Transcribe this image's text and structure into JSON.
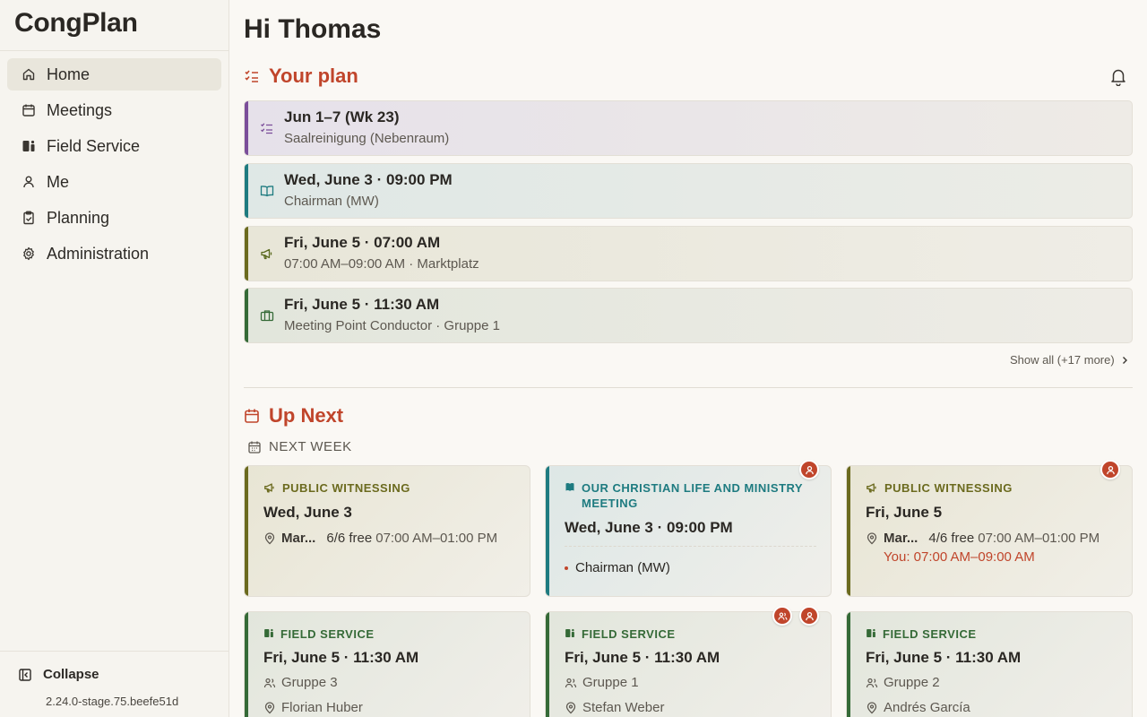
{
  "app": {
    "title": "CongPlan",
    "version": "2.24.0-stage.75.beefe51d"
  },
  "sidebar": {
    "items": [
      {
        "label": "Home",
        "icon": "home-icon",
        "active": true
      },
      {
        "label": "Meetings",
        "icon": "calendar-icon"
      },
      {
        "label": "Field Service",
        "icon": "field-service-icon"
      },
      {
        "label": "Me",
        "icon": "user-icon"
      },
      {
        "label": "Planning",
        "icon": "clipboard-check-icon"
      },
      {
        "label": "Administration",
        "icon": "gear-icon"
      }
    ],
    "collapse_label": "Collapse"
  },
  "greeting": "Hi Thomas",
  "your_plan": {
    "title": "Your plan",
    "items": [
      {
        "title": "Jun 1–7 (Wk 23)",
        "subtitle": "Saalreinigung (Nebenraum)",
        "icon": "checklist-icon",
        "accent": "#7b4e9a"
      },
      {
        "title": "Wed, June 3 · 09:00 PM",
        "subtitle": "Chairman (MW)",
        "icon": "book-open-icon",
        "accent": "#1e7b80"
      },
      {
        "title": "Fri, June 5 · 07:00 AM",
        "subtitle": "07:00 AM–09:00 AM · Marktplatz",
        "icon": "megaphone-icon",
        "accent": "#6b6a1e"
      },
      {
        "title": "Fri, June 5 · 11:30 AM",
        "subtitle": "Meeting Point Conductor · Gruppe 1",
        "icon": "briefcase-icon",
        "accent": "#356a37"
      }
    ],
    "show_all": "Show all (+17 more)"
  },
  "up_next": {
    "title": "Up Next",
    "week_label": "NEXT WEEK",
    "cards": [
      {
        "category": "PUBLIC WITNESSING",
        "title": "Wed, June 3",
        "location": "Mar...",
        "free": "6/6 free",
        "time": "07:00 AM–01:00 PM",
        "accent": "#6b6a1e"
      },
      {
        "category": "OUR CHRISTIAN LIFE AND MINISTRY MEETING",
        "title": "Wed, June 3 · 09:00 PM",
        "role": "Chairman (MW)",
        "accent": "#1e7b80"
      },
      {
        "category": "PUBLIC WITNESSING",
        "title": "Fri, June 5",
        "location": "Mar...",
        "free": "4/6 free",
        "time": "07:00 AM–01:00 PM",
        "you": "You: 07:00 AM–09:00 AM",
        "accent": "#6b6a1e"
      },
      {
        "category": "FIELD SERVICE",
        "title": "Fri, June 5 · 11:30 AM",
        "group": "Gruppe 3",
        "person": "Florian Huber",
        "accent": "#356a37"
      },
      {
        "category": "FIELD SERVICE",
        "title": "Fri, June 5 · 11:30 AM",
        "group": "Gruppe 1",
        "person": "Stefan Weber",
        "accent": "#356a37"
      },
      {
        "category": "FIELD SERVICE",
        "title": "Fri, June 5 · 11:30 AM",
        "group": "Gruppe 2",
        "person": "Andrés García",
        "accent": "#356a37"
      }
    ]
  },
  "colors": {
    "accent_red": "#c0452b",
    "purple": "#7b4e9a",
    "teal": "#1e7b80",
    "olive": "#6b6a1e",
    "green": "#356a37"
  }
}
